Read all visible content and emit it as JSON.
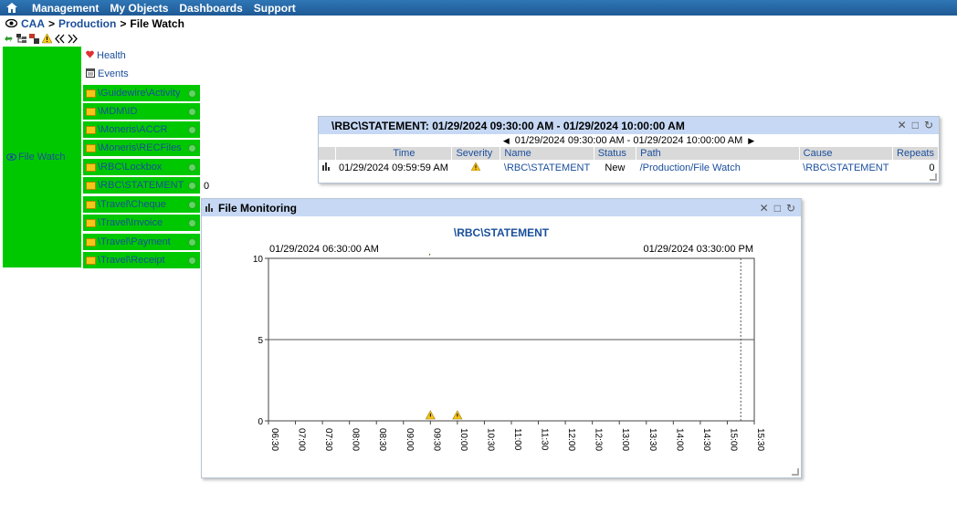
{
  "menu": {
    "items": [
      "Management",
      "My Objects",
      "Dashboards",
      "Support"
    ]
  },
  "breadcrumb": {
    "root": "CAA",
    "sep1": ">",
    "level1": "Production",
    "sep2": ">",
    "current": "File Watch"
  },
  "tree": {
    "parent_label": "File Watch",
    "health_label": "Health",
    "events_label": "Events",
    "children": [
      "\\Guidewire\\Activity",
      "\\MDM\\ID",
      "\\Moneris\\ACCR",
      "\\Moneris\\RECFiles",
      "\\RBC\\Lockbox",
      "\\RBC\\STATEMENT",
      "\\Travel\\Cheque",
      "\\Travel\\Invoice",
      "\\Travel\\Payment",
      "\\Travel\\Receipt"
    ],
    "selected_count": "0"
  },
  "events_panel": {
    "title": "\\RBC\\STATEMENT: 01/29/2024 09:30:00 AM - 01/29/2024 10:00:00 AM",
    "range": "01/29/2024 09:30:00 AM - 01/29/2024 10:00:00 AM",
    "columns": [
      "Time",
      "Severity",
      "Name",
      "Status",
      "Path",
      "Cause",
      "Repeats"
    ],
    "rows": [
      {
        "time": "01/29/2024 09:59:59 AM",
        "severity": "warning",
        "name": "\\RBC\\STATEMENT",
        "status": "New",
        "path": "/Production/File Watch",
        "cause": "\\RBC\\STATEMENT",
        "repeats": "0"
      }
    ]
  },
  "monitor_panel": {
    "title": "File Monitoring",
    "chart_title": "\\RBC\\STATEMENT",
    "start_label": "01/29/2024 06:30:00 AM",
    "end_label": "01/29/2024 03:30:00 PM"
  },
  "chart_data": {
    "type": "scatter",
    "title": "\\RBC\\STATEMENT",
    "x_ticks": [
      "06:30",
      "07:00",
      "07:30",
      "08:00",
      "08:30",
      "09:00",
      "09:30",
      "10:00",
      "10:30",
      "11:00",
      "11:30",
      "12:00",
      "12:30",
      "13:00",
      "13:30",
      "14:00",
      "14:30",
      "15:00",
      "15:30"
    ],
    "y_ticks": [
      0,
      5,
      10
    ],
    "ylim": [
      0,
      10
    ],
    "xlim": [
      "06:30",
      "15:30"
    ],
    "horizontal_line": 5,
    "now_marker": "15:15",
    "warnings": [
      {
        "x": "09:30",
        "y": 0
      },
      {
        "x": "10:00",
        "y": 0
      }
    ],
    "comment_marker": {
      "x": "09:30",
      "y": 10
    },
    "colors": {
      "warning": "#f5c518",
      "line": "#666666"
    }
  }
}
